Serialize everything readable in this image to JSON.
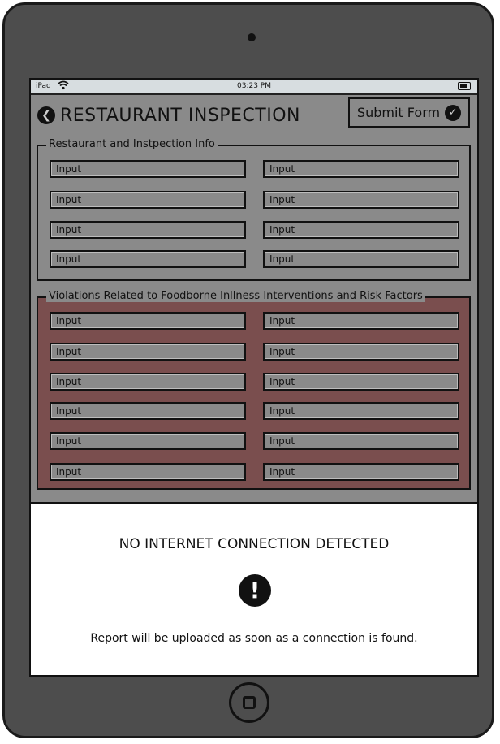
{
  "statusbar": {
    "carrier": "iPad",
    "time": "03:23 PM",
    "icons": [
      "wifi-icon",
      "battery-icon"
    ]
  },
  "header": {
    "title": "RESTAURANT INSPECTION",
    "submit_label": "Submit Form"
  },
  "section1": {
    "legend": "Restaurant and Instpection Info",
    "inputs": [
      "Input",
      "Input",
      "Input",
      "Input",
      "Input",
      "Input",
      "Input",
      "Input"
    ]
  },
  "section2": {
    "legend": "Violations Related to Foodborne Inllness Interventions and Risk Factors",
    "inputs": [
      "Input",
      "Input",
      "Input",
      "Input",
      "Input",
      "Input",
      "Input",
      "Input",
      "Input",
      "Input",
      "Input",
      "Input"
    ]
  },
  "alert": {
    "title": "NO INTERNET CONNECTION DETECTED",
    "icon": "!",
    "message": "Report will be uploaded as soon as a connection is found."
  },
  "colors": {
    "screen_bg": "#8a8a8a",
    "violations_bg": "#7a4e4e",
    "device": "#4d4d4d"
  }
}
